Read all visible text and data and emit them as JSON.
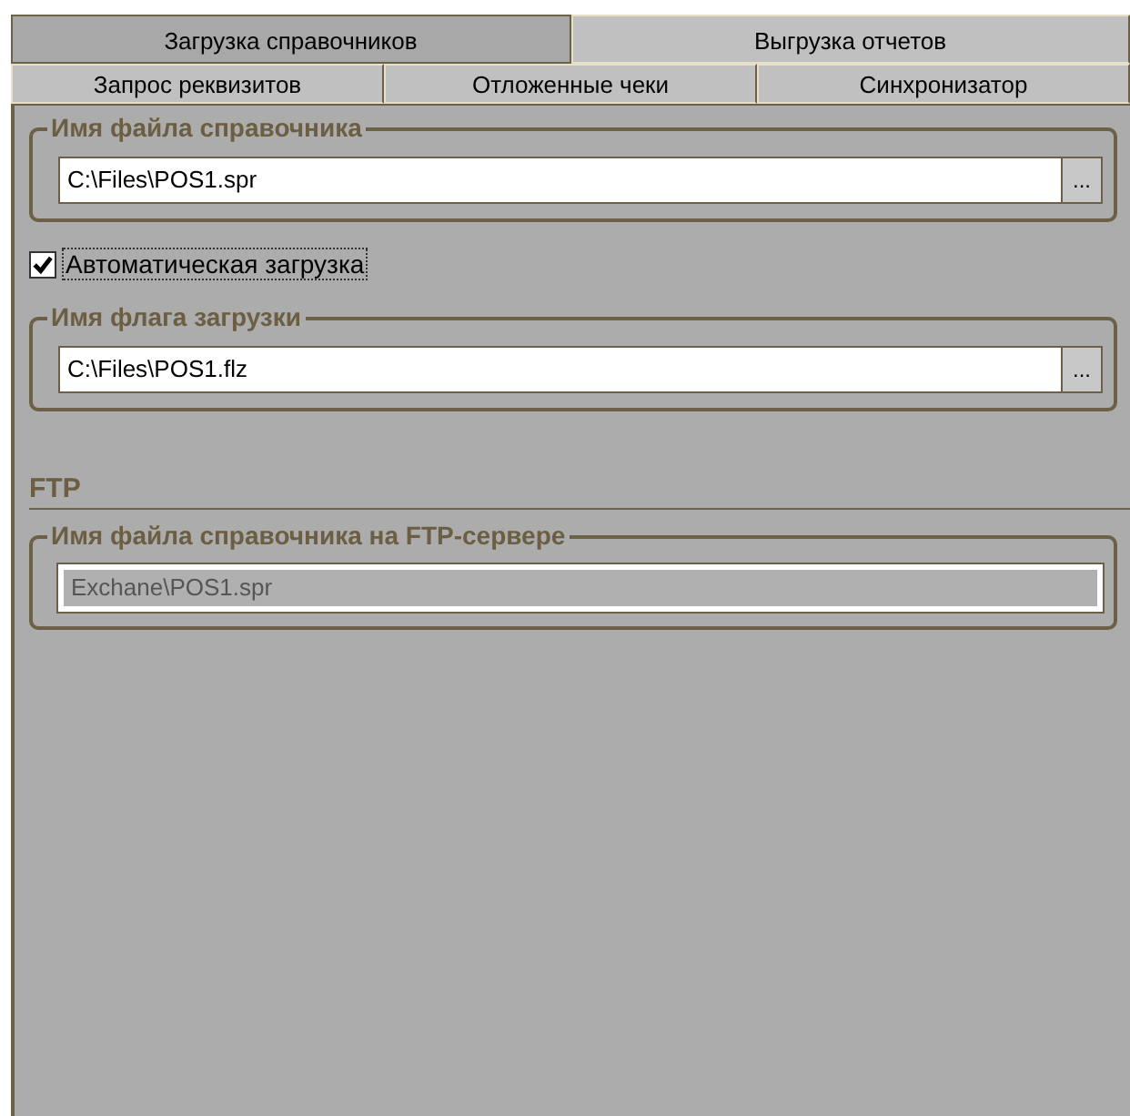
{
  "tab_rows": [
    {
      "tabs": [
        {
          "label": "Загрузка справочников",
          "selected": true
        },
        {
          "label": "Выгрузка отчетов",
          "selected": false
        }
      ]
    },
    {
      "tabs": [
        {
          "label": "Запрос реквизитов",
          "selected": false
        },
        {
          "label": "Отложенные чеки",
          "selected": false
        },
        {
          "label": "Синхронизатор",
          "selected": false
        }
      ]
    }
  ],
  "file_group": {
    "title": "Имя файла справочника",
    "value": "C:\\Files\\POS1.spr",
    "browse": "..."
  },
  "auto_load": {
    "label": "Автоматическая загрузка",
    "checked": true
  },
  "flag_group": {
    "title": "Имя флага загрузки",
    "value": "C:\\Files\\POS1.flz",
    "browse": "..."
  },
  "ftp": {
    "heading": "FTP",
    "group": {
      "title": "Имя файла справочника на FTP-сервере",
      "value": "Exchane\\POS1.spr",
      "disabled": true
    }
  }
}
